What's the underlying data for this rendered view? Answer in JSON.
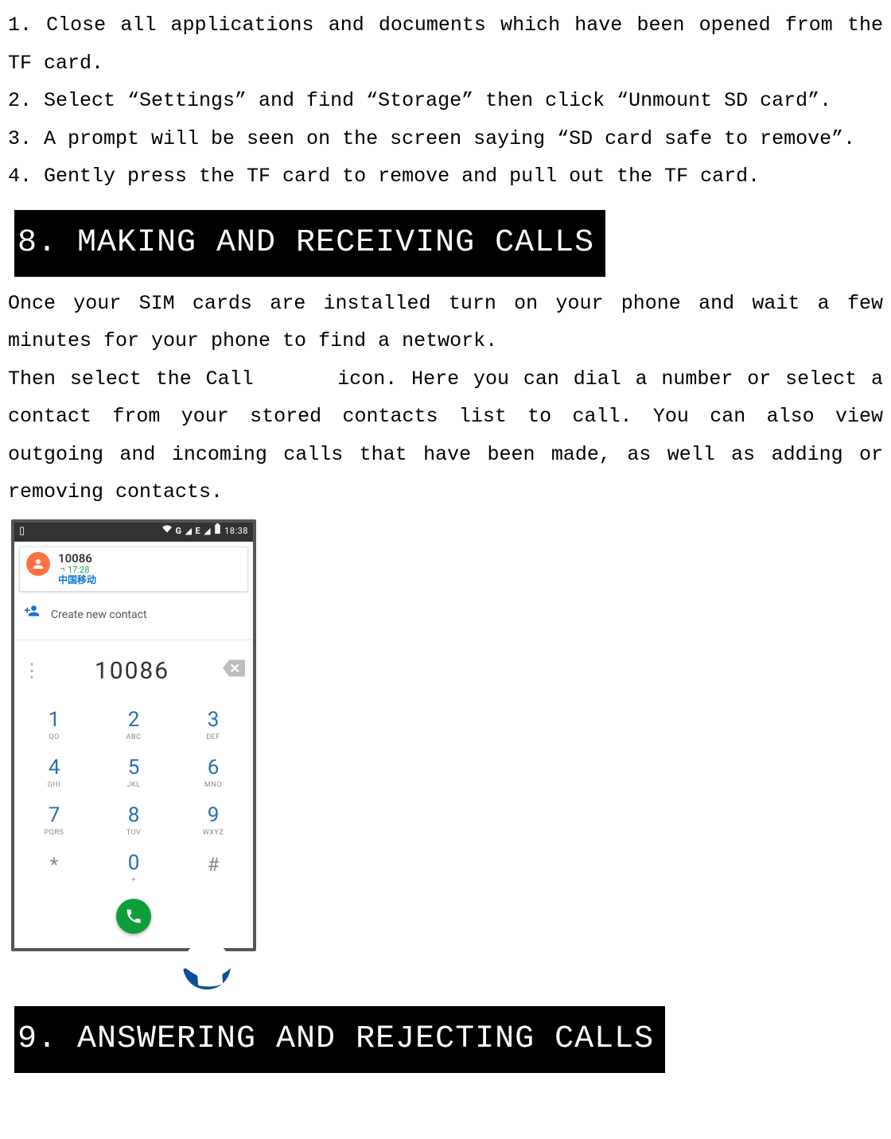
{
  "steps": {
    "s1": "1. Close all applications and documents which have been opened from the TF card.",
    "s2": "2. Select “Settings” and find “Storage” then click “Unmount SD card”.",
    "s3": "3. A prompt will be seen on the screen saying “SD card safe to remove”.",
    "s4": "4. Gently press the TF card to remove and pull out the TF card."
  },
  "heading8": "8. MAKING AND RECEIVING CALLS",
  "intro1": "Once your SIM cards are installed turn on your phone and wait a few minutes for your phone to find a network.",
  "intro2_a": "Then select the Call ",
  "intro2_b": " icon. Here you can dial a number or select a contact from your stored contacts list to call. You can also view outgoing and incoming calls that have been made, as well as adding or removing contacts.",
  "phone": {
    "status": {
      "signal_text": "G",
      "signal_text2": "E",
      "time": "18:38"
    },
    "recent": {
      "number": "10086",
      "time": "17:28",
      "carrier": "中国移动"
    },
    "create_label": "Create new contact",
    "dialed": "10086",
    "keys": [
      {
        "d": "1",
        "l": "QO"
      },
      {
        "d": "2",
        "l": "ABC"
      },
      {
        "d": "3",
        "l": "DEF"
      },
      {
        "d": "4",
        "l": "GHI"
      },
      {
        "d": "5",
        "l": "JKL"
      },
      {
        "d": "6",
        "l": "MNO"
      },
      {
        "d": "7",
        "l": "PQRS"
      },
      {
        "d": "8",
        "l": "TUV"
      },
      {
        "d": "9",
        "l": "WXYZ"
      },
      {
        "d": "*",
        "l": ""
      },
      {
        "d": "0",
        "l": "+"
      },
      {
        "d": "#",
        "l": ""
      }
    ]
  },
  "heading9": "9. ANSWERING AND REJECTING CALLS"
}
